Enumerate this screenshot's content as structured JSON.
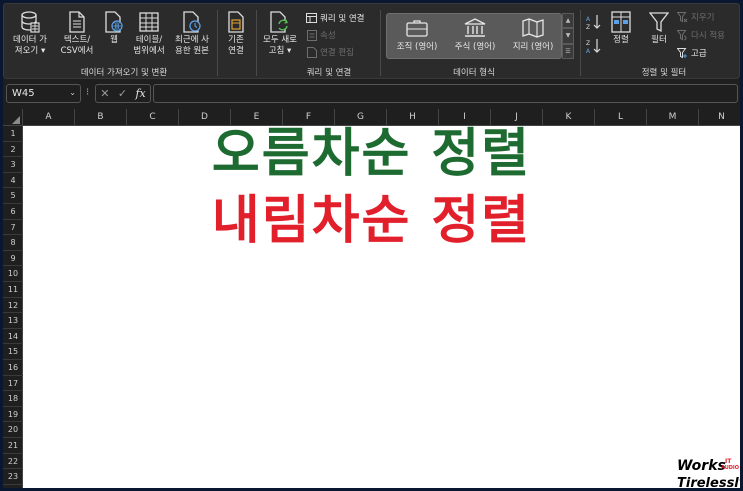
{
  "ribbon": {
    "groups": {
      "get_data": {
        "label": "데이터 가져오기 및 변환",
        "buttons": [
          {
            "line1": "데이터 가",
            "line2": "져오기 ▾",
            "icon": "database-icon"
          },
          {
            "line1": "텍스트/",
            "line2": "CSV에서",
            "icon": "text-file-icon"
          },
          {
            "line1": "웹",
            "line2": "",
            "icon": "web-icon"
          },
          {
            "line1": "테이블/",
            "line2": "범위에서",
            "icon": "table-icon"
          },
          {
            "line1": "최근에 사",
            "line2": "용한 원본",
            "icon": "recent-source-icon"
          },
          {
            "line1": "기존",
            "line2": "연결",
            "icon": "existing-connection-icon"
          }
        ]
      },
      "queries": {
        "label": "쿼리 및 연결",
        "refresh_line1": "모두 새로",
        "refresh_line2": "고침 ▾",
        "small": [
          {
            "label": "쿼리 및 연결",
            "enabled": true
          },
          {
            "label": "속성",
            "enabled": false
          },
          {
            "label": "연결 편집",
            "enabled": false
          }
        ]
      },
      "data_types": {
        "label": "데이터 형식",
        "items": [
          {
            "label": "조직 (영어)",
            "icon": "organization-icon"
          },
          {
            "label": "주식 (영어)",
            "icon": "bank-icon"
          },
          {
            "label": "지리 (영어)",
            "icon": "map-icon"
          }
        ]
      },
      "sort_filter": {
        "label": "정렬 및 필터",
        "sort_label": "정렬",
        "filter_label": "필터",
        "small": [
          {
            "label": "지우기",
            "enabled": false
          },
          {
            "label": "다시 적용",
            "enabled": false
          },
          {
            "label": "고급",
            "enabled": true
          }
        ]
      }
    }
  },
  "formula_bar": {
    "name_box": "W45",
    "fx": "fx",
    "cancel": "✕",
    "enter": "✓",
    "dots": "⁝"
  },
  "grid": {
    "columns": [
      "A",
      "B",
      "C",
      "D",
      "E",
      "F",
      "G",
      "H",
      "I",
      "J",
      "K",
      "L",
      "M",
      "N"
    ],
    "rows": [
      "1",
      "2",
      "3",
      "4",
      "5",
      "6",
      "7",
      "8",
      "9",
      "10",
      "11",
      "12",
      "13",
      "14",
      "15",
      "16",
      "17",
      "18",
      "19",
      "20",
      "21",
      "22",
      "23"
    ]
  },
  "overlay": {
    "line1": "오름차순 정렬",
    "line2": "내림차순 정렬",
    "line1_color": "#1e6b32",
    "line2_color": "#e2202b"
  },
  "watermark": {
    "works": "Works",
    "tirelessly": "Tirelessly",
    "it": "IT",
    "audio": "AUDIO"
  }
}
